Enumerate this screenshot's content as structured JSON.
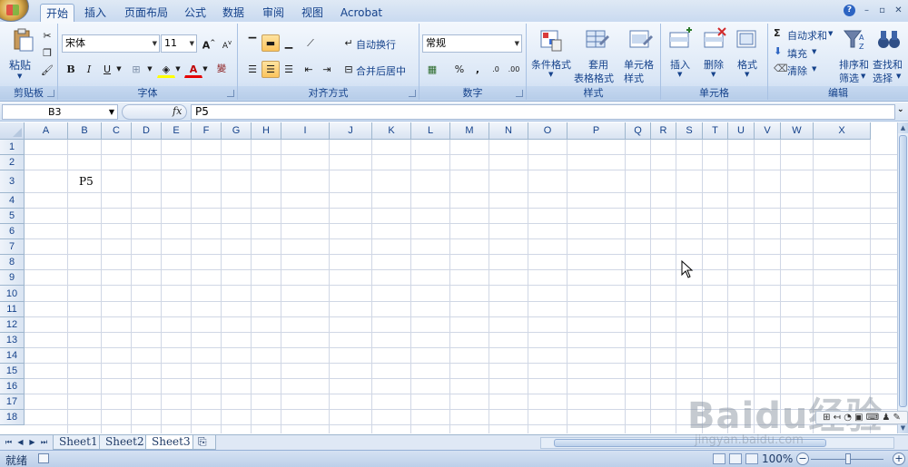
{
  "ribbon": {
    "tabs": [
      "开始",
      "插入",
      "页面布局",
      "公式",
      "数据",
      "审阅",
      "视图",
      "Acrobat"
    ],
    "active_tab": 0,
    "clipboard": {
      "paste": "粘贴",
      "group": "剪贴板"
    },
    "font": {
      "name": "宋体",
      "size": "11",
      "bold": "B",
      "italic": "I",
      "underline": "U",
      "group": "字体"
    },
    "alignment": {
      "wrap_text": "自动换行",
      "merge_center": "合并后居中",
      "group": "对齐方式"
    },
    "number": {
      "format": "常规",
      "percent": "%",
      "comma": ",",
      "group": "数字"
    },
    "styles": {
      "conditional": "条件格式",
      "table_format_1": "套用",
      "table_format_2": "表格格式",
      "cell_styles_1": "单元格",
      "cell_styles_2": "样式",
      "group": "样式"
    },
    "cells": {
      "insert": "插入",
      "delete": "删除",
      "format": "格式",
      "group": "单元格"
    },
    "editing": {
      "autosum": "自动求和",
      "fill": "填充",
      "clear": "清除",
      "sort_1": "排序和",
      "sort_2": "筛选",
      "find_1": "查找和",
      "find_2": "选择",
      "group": "编辑"
    }
  },
  "formula_bar": {
    "name_box": "B3",
    "fx": "fx",
    "content": "P5"
  },
  "grid": {
    "columns": [
      "A",
      "B",
      "C",
      "D",
      "E",
      "F",
      "G",
      "H",
      "I",
      "J",
      "K",
      "L",
      "M",
      "N",
      "O",
      "P",
      "Q",
      "R",
      "S",
      "T",
      "U",
      "V",
      "W",
      "X"
    ],
    "rows": [
      "1",
      "2",
      "3",
      "4",
      "5",
      "6",
      "7",
      "8",
      "9",
      "10",
      "11",
      "12",
      "13",
      "14",
      "15",
      "16",
      "17",
      "18"
    ],
    "cells": {
      "B3": "P5"
    }
  },
  "sheets": {
    "tabs": [
      "Sheet1",
      "Sheet2",
      "Sheet3"
    ],
    "active": 2
  },
  "status": {
    "text": "就绪",
    "zoom": "100%"
  },
  "watermark": {
    "text": "Baidu经验",
    "url": "jingyan.baidu.com"
  },
  "colors": {
    "ribbon_blue": "#15428b",
    "grid_line": "#d0d7e5",
    "accent_orange": "#fbc45c"
  }
}
